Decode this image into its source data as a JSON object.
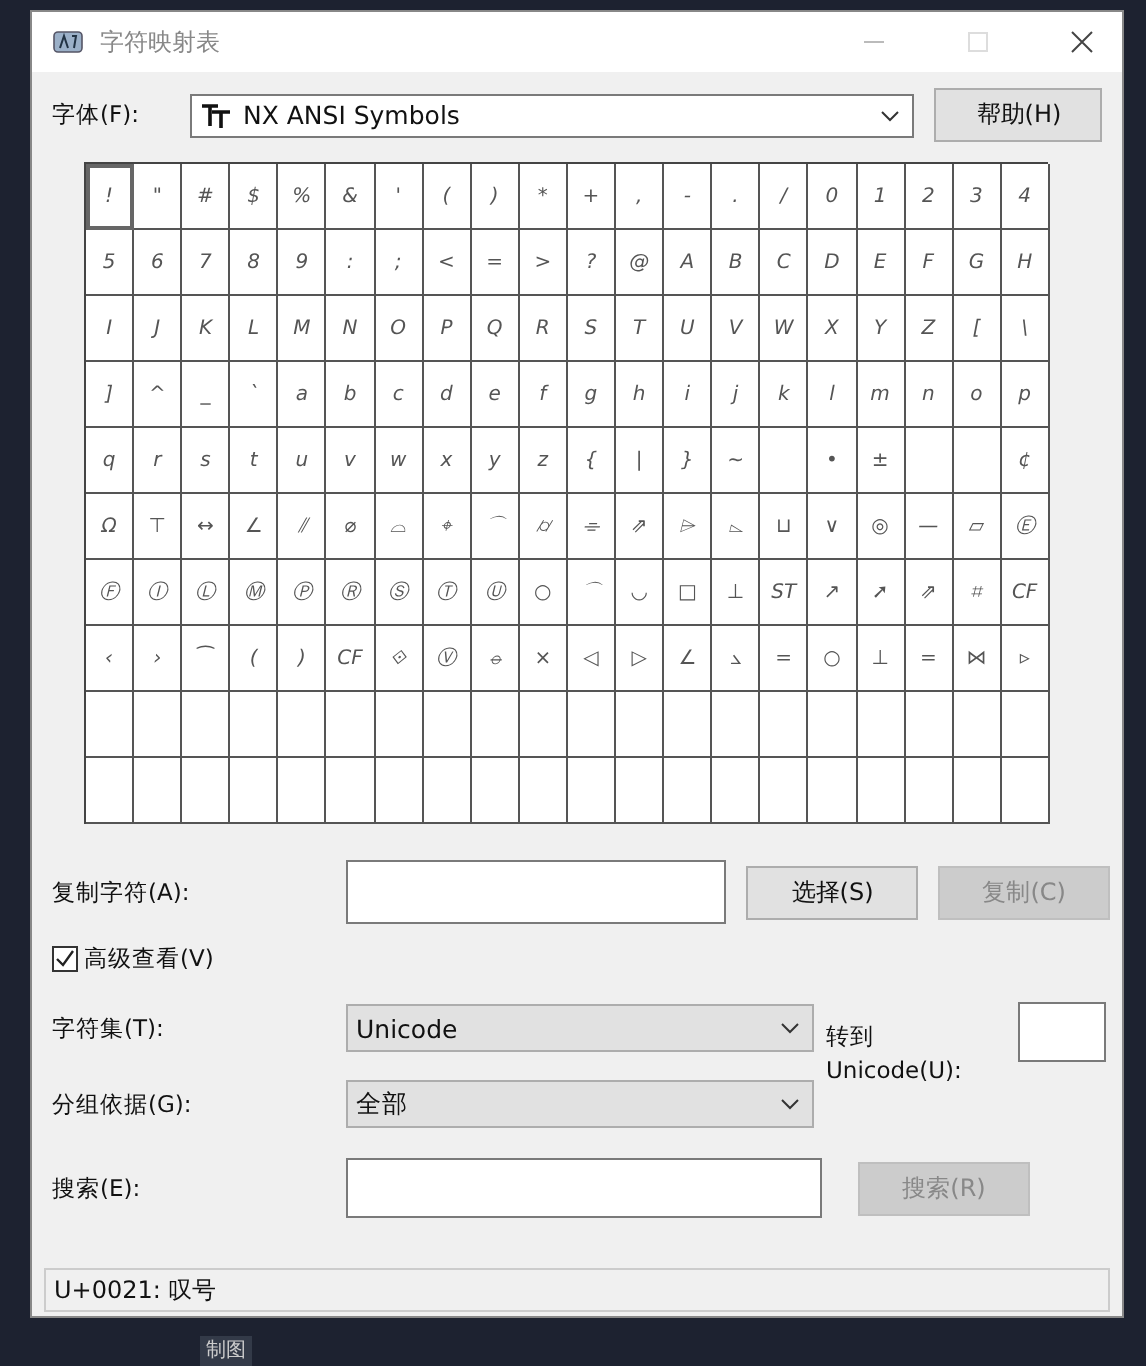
{
  "window": {
    "title": "字符映射表"
  },
  "font_row": {
    "label": "字体(F):",
    "value": "NX ANSI Symbols",
    "button": "帮助(H)"
  },
  "grid": [
    [
      {
        "ch": "!",
        "selected": true
      },
      {
        "ch": "\"",
        "selected": false
      },
      {
        "ch": "#",
        "selected": false
      },
      {
        "ch": "$",
        "selected": false
      },
      {
        "ch": "%",
        "selected": false
      },
      {
        "ch": "&",
        "selected": false
      },
      {
        "ch": "'",
        "selected": false
      },
      {
        "ch": "(",
        "selected": false
      },
      {
        "ch": ")",
        "selected": false
      },
      {
        "ch": "*",
        "selected": false
      },
      {
        "ch": "+",
        "selected": false
      },
      {
        "ch": ",",
        "selected": false
      },
      {
        "ch": "-",
        "selected": false
      },
      {
        "ch": ".",
        "selected": false
      },
      {
        "ch": "/",
        "selected": false
      },
      {
        "ch": "0",
        "selected": false
      },
      {
        "ch": "1",
        "selected": false
      },
      {
        "ch": "2",
        "selected": false
      },
      {
        "ch": "3",
        "selected": false
      },
      {
        "ch": "4",
        "selected": false
      }
    ],
    [
      {
        "ch": "5",
        "selected": false
      },
      {
        "ch": "6",
        "selected": false
      },
      {
        "ch": "7",
        "selected": false
      },
      {
        "ch": "8",
        "selected": false
      },
      {
        "ch": "9",
        "selected": false
      },
      {
        "ch": ":",
        "selected": false
      },
      {
        "ch": ";",
        "selected": false
      },
      {
        "ch": "<",
        "selected": false
      },
      {
        "ch": "=",
        "selected": false
      },
      {
        "ch": ">",
        "selected": false
      },
      {
        "ch": "?",
        "selected": false
      },
      {
        "ch": "@",
        "selected": false
      },
      {
        "ch": "A",
        "selected": false
      },
      {
        "ch": "B",
        "selected": false
      },
      {
        "ch": "C",
        "selected": false
      },
      {
        "ch": "D",
        "selected": false
      },
      {
        "ch": "E",
        "selected": false
      },
      {
        "ch": "F",
        "selected": false
      },
      {
        "ch": "G",
        "selected": false
      },
      {
        "ch": "H",
        "selected": false
      }
    ],
    [
      {
        "ch": "I",
        "selected": false
      },
      {
        "ch": "J",
        "selected": false
      },
      {
        "ch": "K",
        "selected": false
      },
      {
        "ch": "L",
        "selected": false
      },
      {
        "ch": "M",
        "selected": false
      },
      {
        "ch": "N",
        "selected": false
      },
      {
        "ch": "O",
        "selected": false
      },
      {
        "ch": "P",
        "selected": false
      },
      {
        "ch": "Q",
        "selected": false
      },
      {
        "ch": "R",
        "selected": false
      },
      {
        "ch": "S",
        "selected": false
      },
      {
        "ch": "T",
        "selected": false
      },
      {
        "ch": "U",
        "selected": false
      },
      {
        "ch": "V",
        "selected": false
      },
      {
        "ch": "W",
        "selected": false
      },
      {
        "ch": "X",
        "selected": false
      },
      {
        "ch": "Y",
        "selected": false
      },
      {
        "ch": "Z",
        "selected": false
      },
      {
        "ch": "[",
        "selected": false
      },
      {
        "ch": "\\",
        "selected": false
      }
    ],
    [
      {
        "ch": "]",
        "selected": false
      },
      {
        "ch": "^",
        "selected": false
      },
      {
        "ch": "_",
        "selected": false
      },
      {
        "ch": "`",
        "selected": false
      },
      {
        "ch": "a",
        "selected": false
      },
      {
        "ch": "b",
        "selected": false
      },
      {
        "ch": "c",
        "selected": false
      },
      {
        "ch": "d",
        "selected": false
      },
      {
        "ch": "e",
        "selected": false
      },
      {
        "ch": "f",
        "selected": false
      },
      {
        "ch": "g",
        "selected": false
      },
      {
        "ch": "h",
        "selected": false
      },
      {
        "ch": "i",
        "selected": false
      },
      {
        "ch": "j",
        "selected": false
      },
      {
        "ch": "k",
        "selected": false
      },
      {
        "ch": "l",
        "selected": false
      },
      {
        "ch": "m",
        "selected": false
      },
      {
        "ch": "n",
        "selected": false
      },
      {
        "ch": "o",
        "selected": false
      },
      {
        "ch": "p",
        "selected": false
      }
    ],
    [
      {
        "ch": "q",
        "selected": false
      },
      {
        "ch": "r",
        "selected": false
      },
      {
        "ch": "s",
        "selected": false
      },
      {
        "ch": "t",
        "selected": false
      },
      {
        "ch": "u",
        "selected": false
      },
      {
        "ch": "v",
        "selected": false
      },
      {
        "ch": "w",
        "selected": false
      },
      {
        "ch": "x",
        "selected": false
      },
      {
        "ch": "y",
        "selected": false
      },
      {
        "ch": "z",
        "selected": false
      },
      {
        "ch": "{",
        "selected": false
      },
      {
        "ch": "|",
        "selected": false
      },
      {
        "ch": "}",
        "selected": false
      },
      {
        "ch": "~",
        "selected": false
      },
      {
        "selected": false
      },
      {
        "ch": "•",
        "selected": false
      },
      {
        "ch": "±",
        "selected": false
      },
      {
        "selected": false
      },
      {
        "selected": false
      },
      {
        "ch": "¢",
        "selected": false
      }
    ],
    [
      {
        "ch": "Ω",
        "selected": false
      },
      {
        "ch": "⊤",
        "selected": false
      },
      {
        "ch": "↔",
        "selected": false
      },
      {
        "ch": "∠",
        "selected": false
      },
      {
        "ch": "⫽",
        "selected": false
      },
      {
        "ch": "⌀",
        "selected": false
      },
      {
        "ch": "⌓",
        "selected": false
      },
      {
        "ch": "⌖",
        "selected": false
      },
      {
        "ch": "⌒",
        "selected": false
      },
      {
        "ch": "⌭",
        "selected": false
      },
      {
        "ch": "⌯",
        "selected": false
      },
      {
        "ch": "⇗",
        "selected": false
      },
      {
        "ch": "⌲",
        "selected": false
      },
      {
        "ch": "⌳",
        "selected": false
      },
      {
        "ch": "⊔",
        "selected": false
      },
      {
        "ch": "∨",
        "selected": false
      },
      {
        "ch": "◎",
        "selected": false
      },
      {
        "ch": "—",
        "selected": false
      },
      {
        "ch": "▱",
        "selected": false
      },
      {
        "ch": "Ⓔ",
        "selected": false
      }
    ],
    [
      {
        "ch": "Ⓕ",
        "selected": false
      },
      {
        "ch": "Ⓘ",
        "selected": false
      },
      {
        "ch": "Ⓛ",
        "selected": false
      },
      {
        "ch": "Ⓜ",
        "selected": false
      },
      {
        "ch": "Ⓟ",
        "selected": false
      },
      {
        "ch": "Ⓡ",
        "selected": false
      },
      {
        "ch": "Ⓢ",
        "selected": false
      },
      {
        "ch": "Ⓣ",
        "selected": false
      },
      {
        "ch": "Ⓤ",
        "selected": false
      },
      {
        "ch": "○",
        "selected": false
      },
      {
        "ch": "⌒",
        "selected": false
      },
      {
        "ch": "◡",
        "selected": false
      },
      {
        "ch": "□",
        "selected": false
      },
      {
        "ch": "⊥",
        "selected": false
      },
      {
        "ch": "ST",
        "selected": false
      },
      {
        "ch": "↗",
        "selected": false
      },
      {
        "ch": "➚",
        "selected": false
      },
      {
        "ch": "⇗",
        "selected": false
      },
      {
        "ch": "⌗",
        "selected": false
      },
      {
        "ch": "CF",
        "selected": false
      }
    ],
    [
      {
        "ch": "‹",
        "selected": false
      },
      {
        "ch": "›",
        "selected": false
      },
      {
        "ch": "⁀",
        "selected": false
      },
      {
        "ch": "(",
        "selected": false
      },
      {
        "ch": ")",
        "selected": false
      },
      {
        "ch": "CF",
        "selected": false
      },
      {
        "ch": "⟐",
        "selected": false
      },
      {
        "ch": "Ⓥ",
        "selected": false
      },
      {
        "ch": "⦵",
        "selected": false
      },
      {
        "ch": "×",
        "selected": false
      },
      {
        "ch": "◁",
        "selected": false
      },
      {
        "ch": "▷",
        "selected": false
      },
      {
        "ch": "∠",
        "selected": false
      },
      {
        "ch": "⦣",
        "selected": false
      },
      {
        "ch": "=",
        "selected": false
      },
      {
        "ch": "○",
        "selected": false
      },
      {
        "ch": "⊥",
        "selected": false
      },
      {
        "ch": "=",
        "selected": false
      },
      {
        "ch": "⋈",
        "selected": false
      },
      {
        "ch": "▹",
        "selected": false
      }
    ],
    [
      {
        "selected": false
      },
      {
        "selected": false
      },
      {
        "selected": false
      },
      {
        "selected": false
      },
      {
        "selected": false
      },
      {
        "selected": false
      },
      {
        "selected": false
      },
      {
        "selected": false
      },
      {
        "selected": false
      },
      {
        "selected": false
      },
      {
        "selected": false
      },
      {
        "selected": false
      },
      {
        "selected": false
      },
      {
        "selected": false
      },
      {
        "selected": false
      },
      {
        "selected": false
      },
      {
        "selected": false
      },
      {
        "selected": false
      },
      {
        "selected": false
      },
      {
        "selected": false
      }
    ],
    [
      {
        "selected": false
      },
      {
        "selected": false
      },
      {
        "selected": false
      },
      {
        "selected": false
      },
      {
        "selected": false
      },
      {
        "selected": false
      },
      {
        "selected": false
      },
      {
        "selected": false
      },
      {
        "selected": false
      },
      {
        "selected": false
      },
      {
        "selected": false
      },
      {
        "selected": false
      },
      {
        "selected": false
      },
      {
        "selected": false
      },
      {
        "selected": false
      },
      {
        "selected": false
      },
      {
        "selected": false
      },
      {
        "selected": false
      },
      {
        "selected": false
      },
      {
        "selected": false
      }
    ]
  ],
  "copy_row": {
    "label": "复制字符(A):",
    "select_button": "选择(S)",
    "copy_button": {
      "label": "复制(C)",
      "disabled": true
    }
  },
  "advanced_view": {
    "label": "高级查看(V)",
    "checked": true
  },
  "charset": {
    "label": "字符集(T):",
    "value": "Unicode"
  },
  "group_by": {
    "label": "分组依据(G):",
    "value": "全部"
  },
  "goto_unicode": {
    "label": "转到 Unicode(U):"
  },
  "search": {
    "label": "搜索(E):",
    "button": {
      "label": "搜索(R)",
      "disabled": true
    }
  },
  "status_bar": "U+0021: 叹号",
  "background_text": "制图"
}
